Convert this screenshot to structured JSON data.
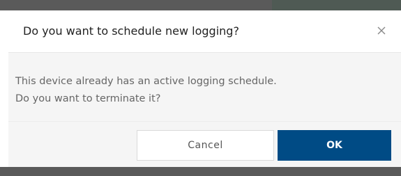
{
  "dialog": {
    "title": "Do you want to schedule new logging?",
    "close_icon": "close-icon",
    "message_lines": [
      "This device already has an active logging schedule.",
      "Do you want to terminate it?"
    ],
    "buttons": {
      "cancel_label": "Cancel",
      "ok_label": "OK"
    }
  },
  "colors": {
    "primary": "#004b85",
    "backdrop": "#5a5a5a",
    "body_bg": "#f5f5f5"
  }
}
